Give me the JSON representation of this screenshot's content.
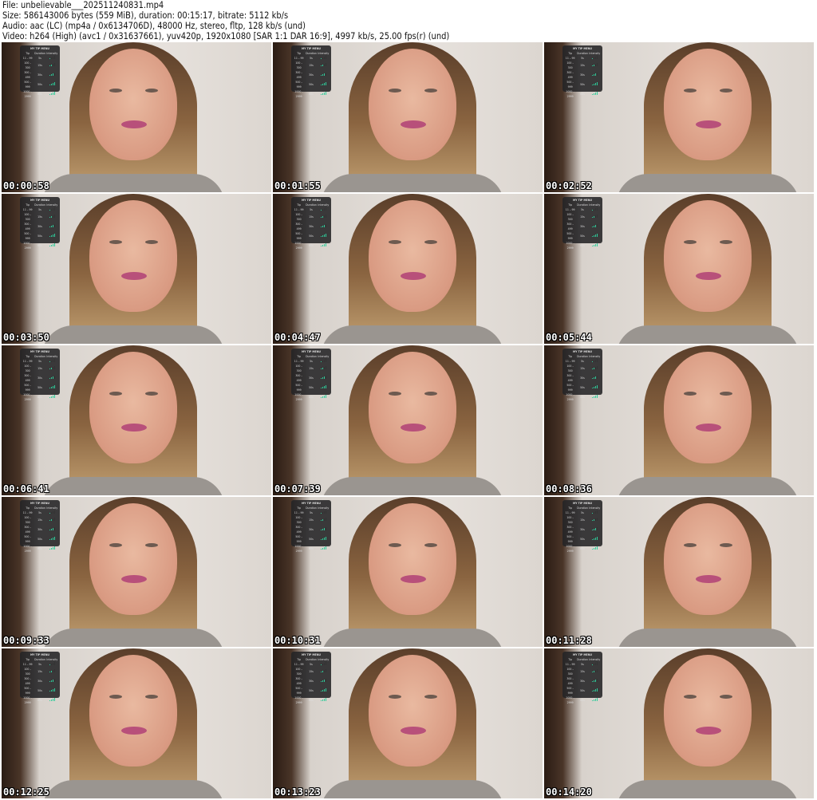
{
  "info": {
    "file": "File: unbelievable___202511240831.mp4",
    "size": "Size: 586143006 bytes (559 MiB), duration: 00:15:17, bitrate: 5112 kb/s",
    "audio": "Audio: aac (LC) (mp4a / 0x6134706D), 48000 Hz, stereo, fltp, 128 kb/s (und)",
    "video": "Video: h264 (High) (avc1 / 0x31637661), yuv420p, 1920x1080 [SAR 1:1 DAR 16:9], 4997 kb/s, 25.00 fps(r) (und)"
  },
  "tip_menu": {
    "title": "MY TIP MENU",
    "headers": [
      "Tip",
      "Duration",
      "Intensity"
    ],
    "rows": [
      {
        "tip": "11 – 99",
        "duration": "5s",
        "intensity": 1
      },
      {
        "tip": "100 – 300",
        "duration": "15s",
        "intensity": 2
      },
      {
        "tip": "300 – 499",
        "duration": "30s",
        "intensity": 3
      },
      {
        "tip": "500 – 999",
        "duration": "50s",
        "intensity": 4
      },
      {
        "tip": "1000 – 2999",
        "duration": "60s",
        "intensity": 4
      }
    ]
  },
  "thumbnails": [
    "00:00:58",
    "00:01:55",
    "00:02:52",
    "00:03:50",
    "00:04:47",
    "00:05:44",
    "00:06:41",
    "00:07:39",
    "00:08:36",
    "00:09:33",
    "00:10:31",
    "00:11:28",
    "00:12:25",
    "00:13:23",
    "00:14:20"
  ]
}
